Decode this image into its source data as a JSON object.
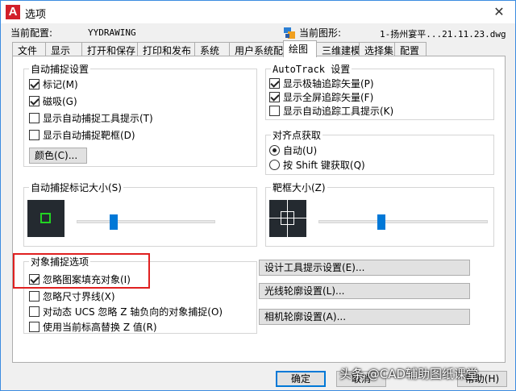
{
  "window": {
    "title": "选项",
    "icon_letter": "A",
    "close_glyph": "✕"
  },
  "info": {
    "profile_label": "当前配置:",
    "profile_value": "YYDRAWING",
    "drawing_label": "当前图形:",
    "drawing_value": "1-扬州宴平...21.11.23.dwg"
  },
  "tabs": [
    {
      "label": "文件"
    },
    {
      "label": "显示"
    },
    {
      "label": "打开和保存"
    },
    {
      "label": "打印和发布"
    },
    {
      "label": "系统"
    },
    {
      "label": "用户系统配置"
    },
    {
      "label": "绘图"
    },
    {
      "label": "三维建模"
    },
    {
      "label": "选择集"
    },
    {
      "label": "配置"
    }
  ],
  "autosnap": {
    "title": "自动捕捉设置",
    "items": [
      {
        "label": "标记(M)",
        "checked": true
      },
      {
        "label": "磁吸(G)",
        "checked": true
      },
      {
        "label": "显示自动捕捉工具提示(T)",
        "checked": false
      },
      {
        "label": "显示自动捕捉靶框(D)",
        "checked": false
      }
    ],
    "color_button": "颜色(C)..."
  },
  "autotrack": {
    "title": "AutoTrack 设置",
    "items": [
      {
        "label": "显示极轴追踪矢量(P)",
        "checked": true
      },
      {
        "label": "显示全屏追踪矢量(F)",
        "checked": true
      },
      {
        "label": "显示自动追踪工具提示(K)",
        "checked": false
      }
    ]
  },
  "alignment": {
    "title": "对齐点获取",
    "options": [
      {
        "label": "自动(U)",
        "selected": true
      },
      {
        "label": "按 Shift 键获取(Q)",
        "selected": false
      }
    ]
  },
  "marker_size": {
    "title": "自动捕捉标记大小(S)",
    "slider_fraction": 0.27
  },
  "aperture_size": {
    "title": "靶框大小(Z)",
    "slider_fraction": 0.37
  },
  "osnap": {
    "title": "对象捕捉选项",
    "items": [
      {
        "label": "忽略图案填充对象(I)",
        "checked": true
      },
      {
        "label": "忽略尺寸界线(X)",
        "checked": false
      },
      {
        "label": "对动态 UCS 忽略 Z 轴负向的对象捕捉(O)",
        "checked": false
      },
      {
        "label": "使用当前标高替换 Z 值(R)",
        "checked": false
      }
    ]
  },
  "side_buttons": {
    "design_tooltip": "设计工具提示设置(E)...",
    "light_glyph": "光线轮廓设置(L)...",
    "camera_glyph": "相机轮廓设置(A)..."
  },
  "footer": {
    "ok": "确定",
    "cancel": "取消",
    "help": "帮助(H)"
  },
  "watermark": "头条 @CAD辅助图纸课堂"
}
